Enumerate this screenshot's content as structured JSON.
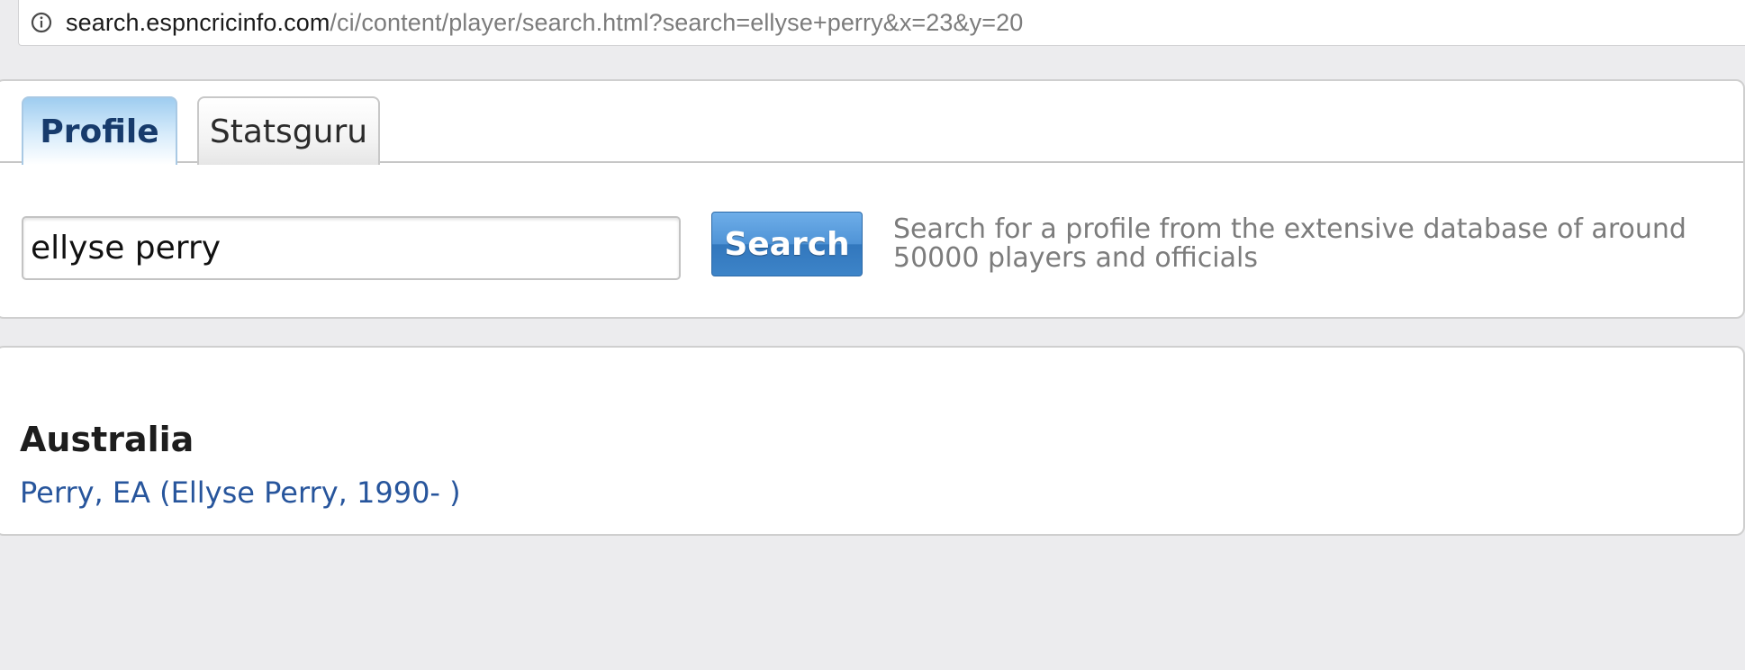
{
  "browser": {
    "url_domain": "search.espncricinfo.com",
    "url_path": "/ci/content/player/search.html?search=ellyse+perry&x=23&y=20",
    "info_icon": "info-circle-icon"
  },
  "tabs": [
    {
      "label": "Profile",
      "active": true
    },
    {
      "label": "Statsguru",
      "active": false
    }
  ],
  "search": {
    "value": "ellyse perry",
    "button_label": "Search",
    "help_text": "Search for a profile from the extensive database of around 50000 players and officials"
  },
  "results": [
    {
      "country": "Australia",
      "players": [
        "Perry, EA (Ellyse Perry, 1990- )"
      ]
    }
  ],
  "colors": {
    "page_background": "#ececee",
    "active_tab_text": "#173b6c",
    "search_button": "#3d84c8",
    "link": "#27559c",
    "muted_text": "#7c7c7c"
  }
}
